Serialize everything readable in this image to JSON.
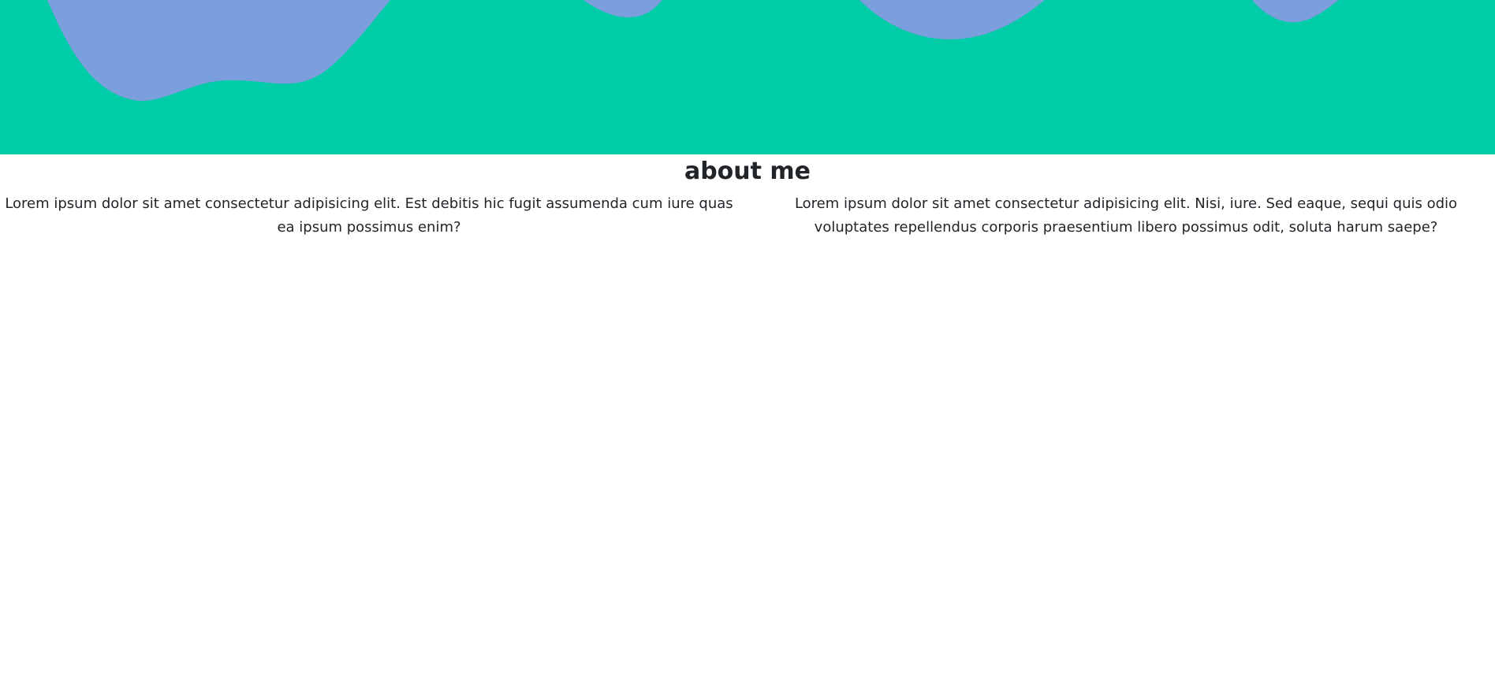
{
  "colors": {
    "hero_background": "#00cca8",
    "blob": "#7b9edc",
    "text": "#212529",
    "page_background": "#ffffff"
  },
  "about": {
    "title": "about me",
    "paragraphs": [
      "Lorem ipsum dolor sit amet consectetur adipisicing elit. Est debitis hic fugit assumenda cum iure quas ea ipsum possimus enim?",
      "Lorem ipsum dolor sit amet consectetur adipisicing elit. Nisi, iure. Sed eaque, sequi quis odio voluptates repellendus corporis praesentium libero possimus odit, soluta harum saepe?"
    ]
  }
}
